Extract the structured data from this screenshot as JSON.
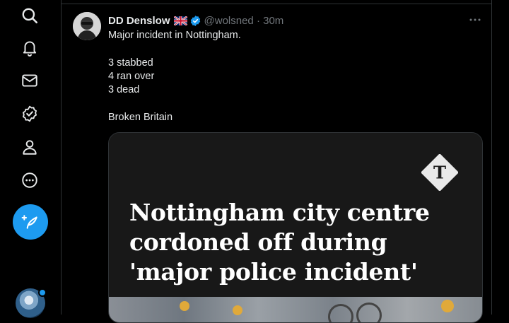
{
  "nav": {
    "items": [
      {
        "icon": "search-icon",
        "label": "Explore"
      },
      {
        "icon": "bell-icon",
        "label": "Notifications"
      },
      {
        "icon": "mail-icon",
        "label": "Messages"
      },
      {
        "icon": "verified-badge-icon",
        "label": "Verified"
      },
      {
        "icon": "profile-icon",
        "label": "Profile"
      },
      {
        "icon": "more-circle-icon",
        "label": "More"
      }
    ],
    "compose_icon": "feather-plus-icon",
    "accent": "#1d9bf0"
  },
  "tweet": {
    "author_name": "DD Denslow",
    "flag_icon": "uk-flag-icon",
    "verified_icon": "verified-icon",
    "handle_time": "@wolsned · 30m",
    "lines": [
      "Major incident in Nottingham.",
      "",
      "3 stabbed",
      "4 ran over",
      "3 dead",
      "",
      "Broken Britain"
    ],
    "card": {
      "logo_icon": "telegraph-logo-icon",
      "headline": "Nottingham city centre cordoned off during 'major police incident'"
    }
  }
}
